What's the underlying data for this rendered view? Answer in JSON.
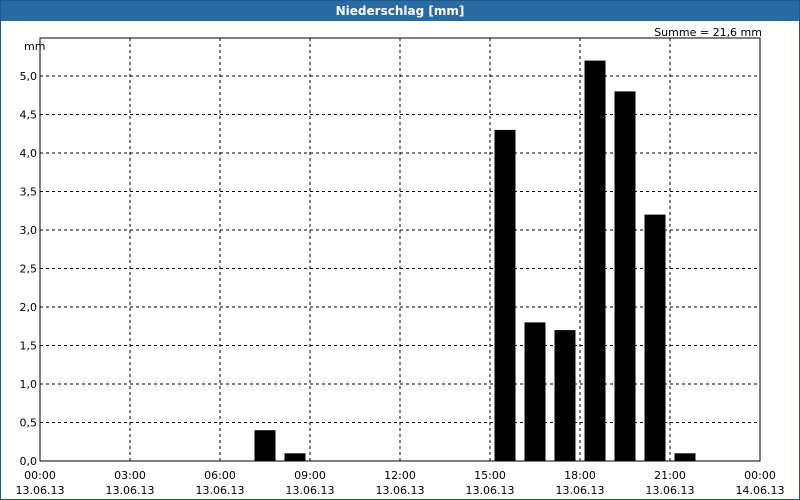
{
  "title": "Niederschlag [mm]",
  "summary": "Summe = 21,6 mm",
  "colors": {
    "bar": "#000000",
    "titlebar": "#2a6aa3"
  },
  "chart_data": {
    "type": "bar",
    "title": "Niederschlag [mm]",
    "ylabel": "mm",
    "ylim": [
      0,
      5.4
    ],
    "yticks": [
      "0,0",
      "0,5",
      "1,0",
      "1,5",
      "2,0",
      "2,5",
      "3,0",
      "3,5",
      "4,0",
      "4,5",
      "5,0"
    ],
    "xlim_hours": [
      0,
      24
    ],
    "xticks": [
      {
        "time": "00:00",
        "date": "13.06.13"
      },
      {
        "time": "03:00",
        "date": "13.06.13"
      },
      {
        "time": "06:00",
        "date": "13.06.13"
      },
      {
        "time": "09:00",
        "date": "13.06.13"
      },
      {
        "time": "12:00",
        "date": "13.06.13"
      },
      {
        "time": "15:00",
        "date": "13.06.13"
      },
      {
        "time": "18:00",
        "date": "13.06.13"
      },
      {
        "time": "21:00",
        "date": "13.06.13"
      },
      {
        "time": "00:00",
        "date": "14.06.13"
      }
    ],
    "grid": true,
    "bars": [
      {
        "hour": "07:00",
        "value": 0.4
      },
      {
        "hour": "08:00",
        "value": 0.1
      },
      {
        "hour": "15:00",
        "value": 4.3
      },
      {
        "hour": "16:00",
        "value": 1.8
      },
      {
        "hour": "17:00",
        "value": 1.7
      },
      {
        "hour": "18:00",
        "value": 5.2
      },
      {
        "hour": "19:00",
        "value": 4.8
      },
      {
        "hour": "20:00",
        "value": 3.2
      },
      {
        "hour": "21:00",
        "value": 0.1
      }
    ]
  }
}
